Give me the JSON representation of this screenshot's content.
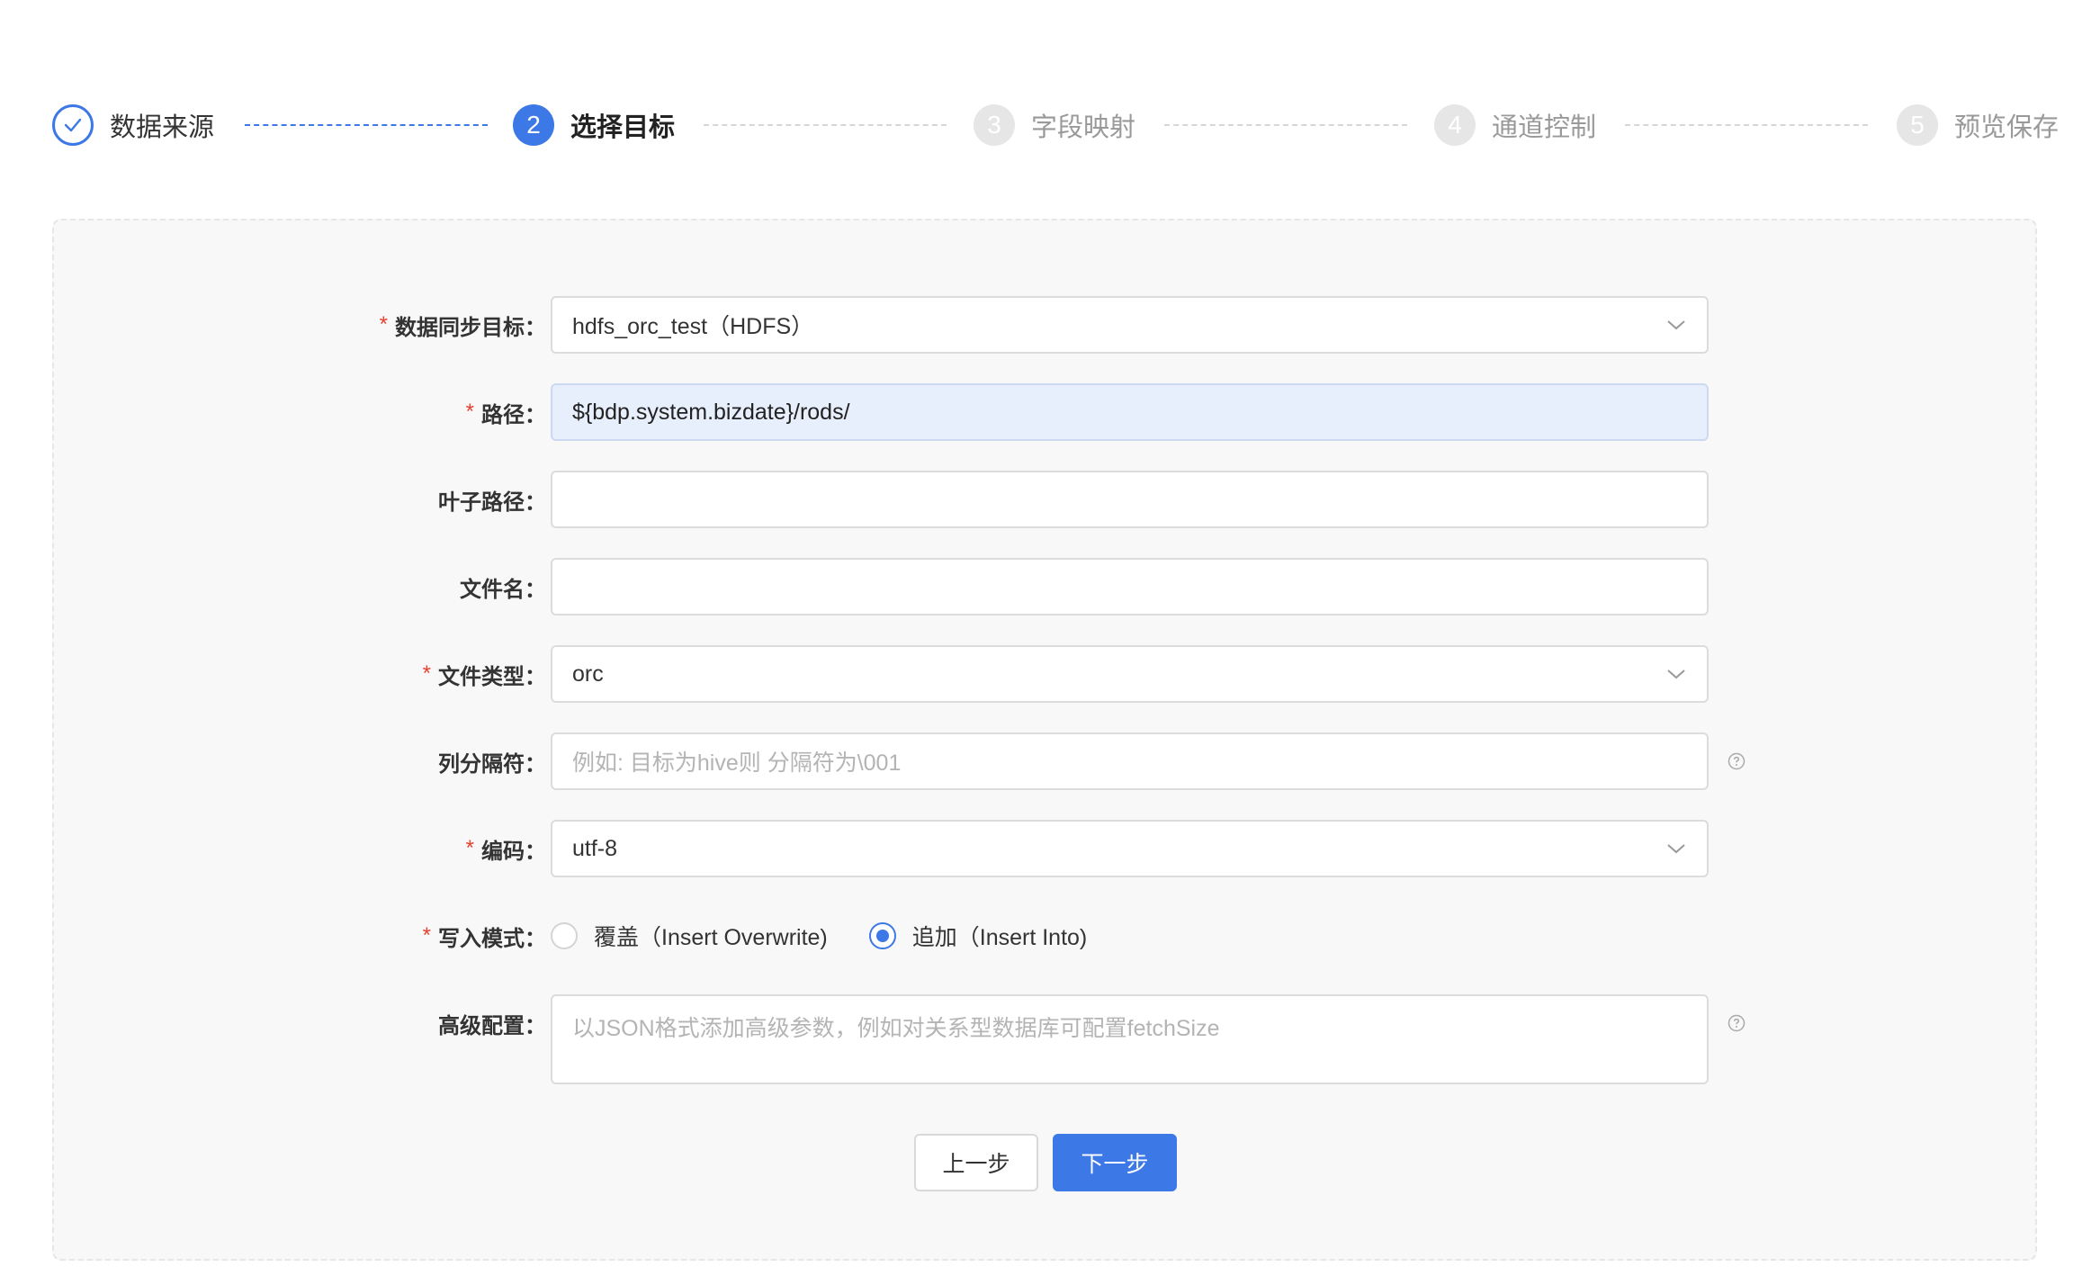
{
  "colors": {
    "primary": "#3c78e6",
    "required": "#e8412f",
    "highlight_bg": "#e8effc"
  },
  "steps": [
    {
      "index": "1",
      "title": "数据来源",
      "status": "done",
      "icon": "check-icon"
    },
    {
      "index": "2",
      "title": "选择目标",
      "status": "active"
    },
    {
      "index": "3",
      "title": "字段映射",
      "status": "wait"
    },
    {
      "index": "4",
      "title": "通道控制",
      "status": "wait"
    },
    {
      "index": "5",
      "title": "预览保存",
      "status": "wait"
    }
  ],
  "form": {
    "target": {
      "label": "数据同步目标：",
      "value": "hdfs_orc_test（HDFS）",
      "icon": "chevron-down-icon"
    },
    "path": {
      "label": "路径：",
      "value": "${bdp.system.bizdate}/rods/"
    },
    "leaf_path": {
      "label": "叶子路径：",
      "value": ""
    },
    "file_name": {
      "label": "文件名：",
      "value": ""
    },
    "file_type": {
      "label": "文件类型：",
      "value": "orc",
      "icon": "chevron-down-icon"
    },
    "delimiter": {
      "label": "列分隔符：",
      "placeholder": "例如: 目标为hive则 分隔符为\\001",
      "icon": "question-circle-icon"
    },
    "encoding": {
      "label": "编码：",
      "value": "utf-8",
      "icon": "chevron-down-icon"
    },
    "write_mode": {
      "label": "写入模式：",
      "options": [
        {
          "label": "覆盖（Insert Overwrite)",
          "checked": false
        },
        {
          "label": "追加（Insert Into)",
          "checked": true
        }
      ]
    },
    "advanced": {
      "label": "高级配置：",
      "placeholder": "以JSON格式添加高级参数，例如对关系型数据库可配置fetchSize",
      "icon": "question-circle-icon"
    },
    "required_mark": "*"
  },
  "buttons": {
    "prev": "上一步",
    "next": "下一步"
  }
}
